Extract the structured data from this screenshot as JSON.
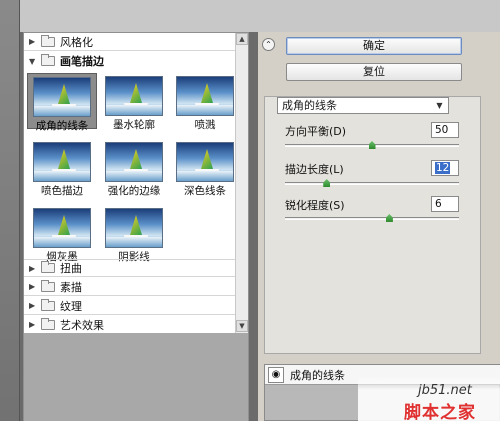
{
  "filter_gallery": {
    "categories": [
      {
        "label": "风格化",
        "expanded": false
      },
      {
        "label": "画笔描边",
        "expanded": true
      },
      {
        "label": "扭曲",
        "expanded": false
      },
      {
        "label": "素描",
        "expanded": false
      },
      {
        "label": "纹理",
        "expanded": false
      },
      {
        "label": "艺术效果",
        "expanded": false
      }
    ],
    "thumbnails": [
      {
        "label": "成角的线条",
        "selected": true
      },
      {
        "label": "墨水轮廓",
        "selected": false
      },
      {
        "label": "喷溅",
        "selected": false
      },
      {
        "label": "喷色描边",
        "selected": false
      },
      {
        "label": "强化的边缘",
        "selected": false
      },
      {
        "label": "深色线条",
        "selected": false
      },
      {
        "label": "烟灰墨",
        "selected": false
      },
      {
        "label": "阴影线",
        "selected": false
      }
    ]
  },
  "buttons": {
    "ok_label": "确定",
    "reset_label": "复位"
  },
  "filter_select": {
    "value": "成角的线条"
  },
  "params": [
    {
      "label": "方向平衡(D)",
      "value": "50",
      "level": 0.5
    },
    {
      "label": "描边长度(L)",
      "value": "12",
      "level": 0.24
    },
    {
      "label": "锐化程度(S)",
      "value": "6",
      "level": 0.6
    }
  ],
  "layers": {
    "row_label": "成角的线条"
  },
  "watermark": {
    "url": "jb51.net",
    "name": "脚本之家"
  },
  "icons": {
    "collapse": "double-chevron-up-icon",
    "eye": "eye-icon",
    "folder": "folder-icon"
  }
}
